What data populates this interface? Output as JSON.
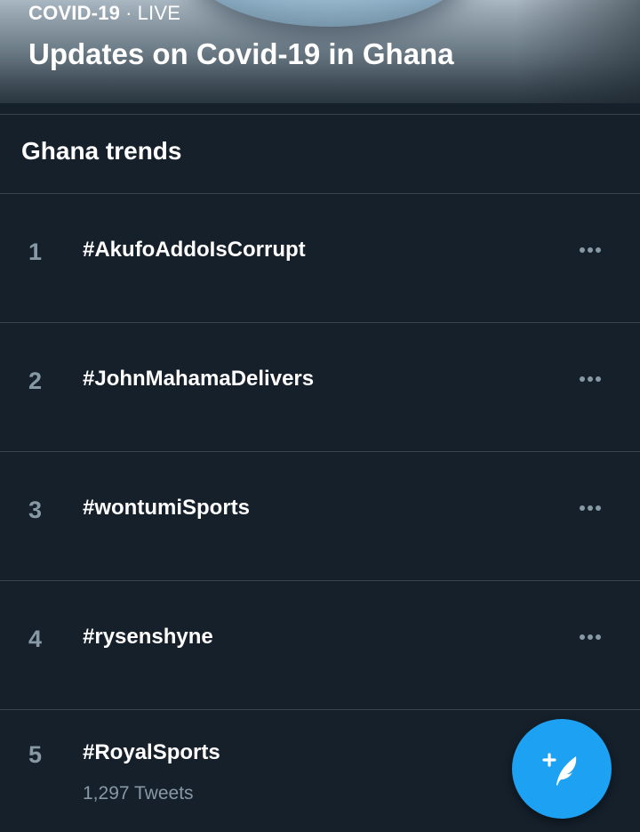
{
  "banner": {
    "category": "COVID-19",
    "separator": "·",
    "status": "LIVE",
    "title": "Updates on Covid-19 in Ghana"
  },
  "section": {
    "title": "Ghana trends"
  },
  "trends": [
    {
      "rank": "1",
      "name": "#AkufoAddoIsCorrupt"
    },
    {
      "rank": "2",
      "name": "#JohnMahamaDelivers"
    },
    {
      "rank": "3",
      "name": "#wontumiSports"
    },
    {
      "rank": "4",
      "name": "#rysenshyne"
    },
    {
      "rank": "5",
      "name": "#RoyalSports",
      "count": "1,297 Tweets"
    }
  ],
  "icons": {
    "more": "more-options-icon",
    "compose": "compose-tweet-icon"
  },
  "colors": {
    "background": "#15202b",
    "accent": "#1da1f2",
    "secondary_text": "#8899a6",
    "divider": "#38444d"
  }
}
